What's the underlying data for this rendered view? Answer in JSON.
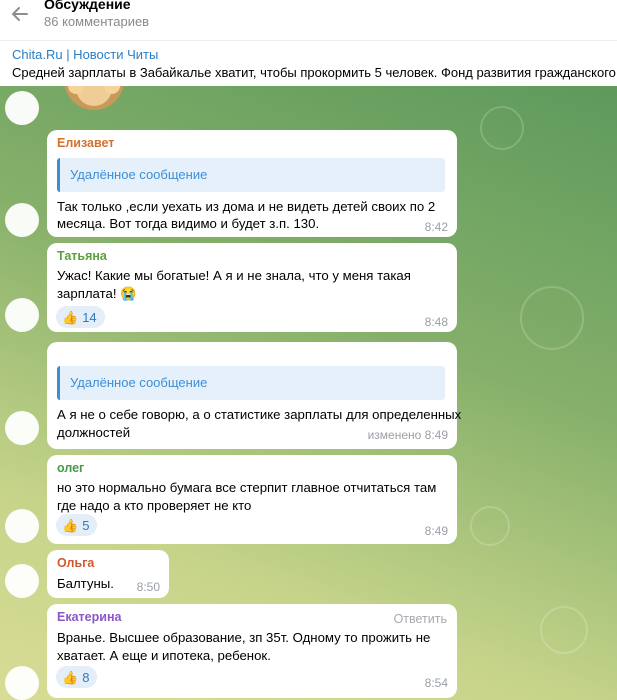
{
  "header": {
    "title": "Обсуждение",
    "subtitle": "86 комментариев"
  },
  "pinned": {
    "source": "Chita.Ru | Новости Читы",
    "text": "Средней зарплаты в Забайкалье хватит, чтобы прокормить 5 человек.  Фонд развития гражданского о"
  },
  "messages": [
    {
      "author": "Елизавет",
      "reply_to": "Удалённое сообщение",
      "lines": [
        "Так только ,если уехать из дома и не видеть детей своих по 2",
        "месяца. Вот тогда видимо и будет з.п. 130."
      ],
      "time": "8:42"
    },
    {
      "author": "Татьяна",
      "lines": [
        "Ужас! Какие мы богатые! А я и не знала, что у меня такая",
        "зарплата! 😭"
      ],
      "reaction": {
        "emoji": "👍",
        "count": "14"
      },
      "time": "8:48"
    },
    {
      "reply_to": "Удалённое сообщение",
      "lines": [
        "А я не о себе говорю, а о статистике зарплаты для определенных",
        "должностей"
      ],
      "time": "изменено 8:49"
    },
    {
      "author": "олег",
      "lines": [
        "но это нормально бумага все стерпит главное отчитаться там",
        "где надо а кто проверяет не кто"
      ],
      "reaction": {
        "emoji": "👍",
        "count": "5"
      },
      "time": "8:49"
    },
    {
      "author": "Ольга",
      "lines": [
        "Балтуны."
      ],
      "time": "8:50"
    },
    {
      "author": "Екатерина",
      "reply_button": "Ответить",
      "lines": [
        "Вранье. Высшее образование, зп 35т. Одному то прожить не",
        "хватает. А еще и ипотека, ребенок."
      ],
      "reaction": {
        "emoji": "👍",
        "count": "8"
      },
      "time": "8:54"
    }
  ],
  "colors": {
    "author_0": "#d2722c",
    "author_1": "#5aa03c",
    "author_3": "#4a9a45",
    "author_4": "#d25a2c",
    "author_5": "#8a56c8",
    "link": "#2a7fc4"
  }
}
